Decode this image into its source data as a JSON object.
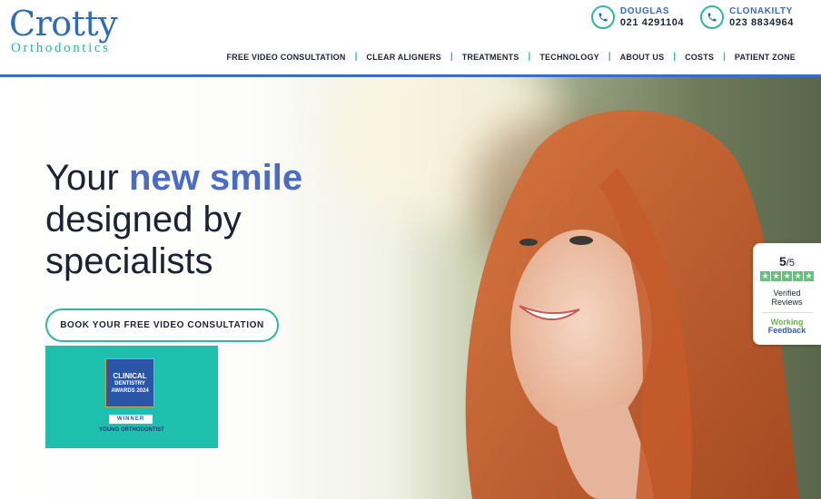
{
  "logo": {
    "main": "Crotty",
    "sub": "Orthodontics"
  },
  "phones": [
    {
      "name": "DOUGLAS",
      "number": "021 4291104",
      "icon": "phone-icon"
    },
    {
      "name": "CLONAKILTY",
      "number": "023 8834964",
      "icon": "phone-icon"
    }
  ],
  "nav": {
    "items": [
      "FREE VIDEO CONSULTATION",
      "CLEAR ALIGNERS",
      "TREATMENTS",
      "TECHNOLOGY",
      "ABOUT US",
      "COSTS",
      "PATIENT ZONE"
    ],
    "separator": "|"
  },
  "hero": {
    "line1_prefix": "Your ",
    "line1_accent": "new smile",
    "line2": "designed by",
    "line3": "specialists",
    "cta_label": "BOOK YOUR FREE VIDEO CONSULTATION"
  },
  "award": {
    "line1": "CLINICAL",
    "line2": "DENTISTRY",
    "line3": "AWARDS 2024",
    "winner": "WINNER",
    "category": "YOUNG ORTHODONTIST"
  },
  "reviews": {
    "score": "5",
    "out_of": "/5",
    "stars": 5,
    "label1": "Verified",
    "label2": "Reviews",
    "brand1": "Working",
    "brand2": "Feedback"
  },
  "colors": {
    "brand_blue": "#2f6cb5",
    "accent_teal": "#2fb89c",
    "headline_accent": "#4a6cc4",
    "award_bg": "#1fbfae"
  }
}
